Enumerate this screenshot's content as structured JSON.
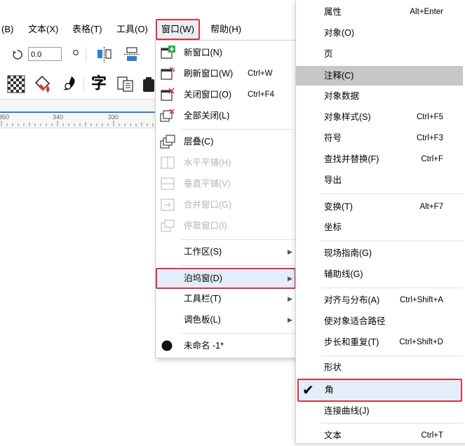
{
  "menubar": {
    "items": [
      {
        "text": "(B)"
      },
      {
        "text": "文本(X)"
      },
      {
        "text": "表格(T)"
      },
      {
        "text": "工具(O)"
      },
      {
        "text": "窗口(W)"
      },
      {
        "text": "帮助(H)"
      }
    ]
  },
  "toolbar": {
    "rotation_value": "0.0",
    "degree_symbol": "o",
    "char_icon_glyph": "字"
  },
  "ruler": {
    "ticks": [
      "350",
      "340",
      "330"
    ]
  },
  "window_menu": {
    "items": [
      {
        "label": "新窗口(N)",
        "shortcut": ""
      },
      {
        "label": "刷新窗口(W)",
        "shortcut": "Ctrl+W"
      },
      {
        "label": "关闭窗口(O)",
        "shortcut": "Ctrl+F4"
      },
      {
        "label": "全部关闭(L)",
        "shortcut": ""
      },
      {
        "label": "层叠(C)",
        "shortcut": ""
      },
      {
        "label": "水平平铺(H)",
        "shortcut": ""
      },
      {
        "label": "垂直平铺(V)",
        "shortcut": ""
      },
      {
        "label": "合并窗口(G)",
        "shortcut": ""
      },
      {
        "label": "停靠窗口(I)",
        "shortcut": ""
      },
      {
        "label": "工作区(S)",
        "shortcut": ""
      },
      {
        "label": "泊坞窗(D)",
        "shortcut": ""
      },
      {
        "label": "工具栏(T)",
        "shortcut": ""
      },
      {
        "label": "调色板(L)",
        "shortcut": ""
      },
      {
        "label": "未命名 -1*",
        "shortcut": ""
      }
    ],
    "arrow": "▶"
  },
  "dockers_menu": {
    "items": [
      {
        "label": "属性",
        "shortcut": "Alt+Enter"
      },
      {
        "label": "对象(O)",
        "shortcut": ""
      },
      {
        "label": "页",
        "shortcut": ""
      },
      {
        "label": "注释(C)",
        "shortcut": ""
      },
      {
        "label": "对象数据",
        "shortcut": ""
      },
      {
        "label": "对象样式(S)",
        "shortcut": "Ctrl+F5"
      },
      {
        "label": "符号",
        "shortcut": "Ctrl+F3"
      },
      {
        "label": "查找并替换(F)",
        "shortcut": "Ctrl+F"
      },
      {
        "label": "导出",
        "shortcut": ""
      },
      {
        "label": "变换(T)",
        "shortcut": "Alt+F7"
      },
      {
        "label": "坐标",
        "shortcut": ""
      },
      {
        "label": "现场指南(G)",
        "shortcut": ""
      },
      {
        "label": "辅助线(G)",
        "shortcut": ""
      },
      {
        "label": "对齐与分布(A)",
        "shortcut": "Ctrl+Shift+A"
      },
      {
        "label": "使对象适合路径",
        "shortcut": ""
      },
      {
        "label": "步长和重复(T)",
        "shortcut": "Ctrl+Shift+D"
      },
      {
        "label": "形状",
        "shortcut": ""
      },
      {
        "label": "角",
        "shortcut": ""
      },
      {
        "label": "连接曲线(J)",
        "shortcut": ""
      },
      {
        "label": "文本",
        "shortcut": "Ctrl+T"
      }
    ],
    "checkmark": "✔"
  },
  "colors": {
    "highlight_red": "#e0323c",
    "hover_blue": "#e3eefa",
    "selected_gray": "#c7c7c7",
    "disabled_text": "#b5b5b5"
  }
}
